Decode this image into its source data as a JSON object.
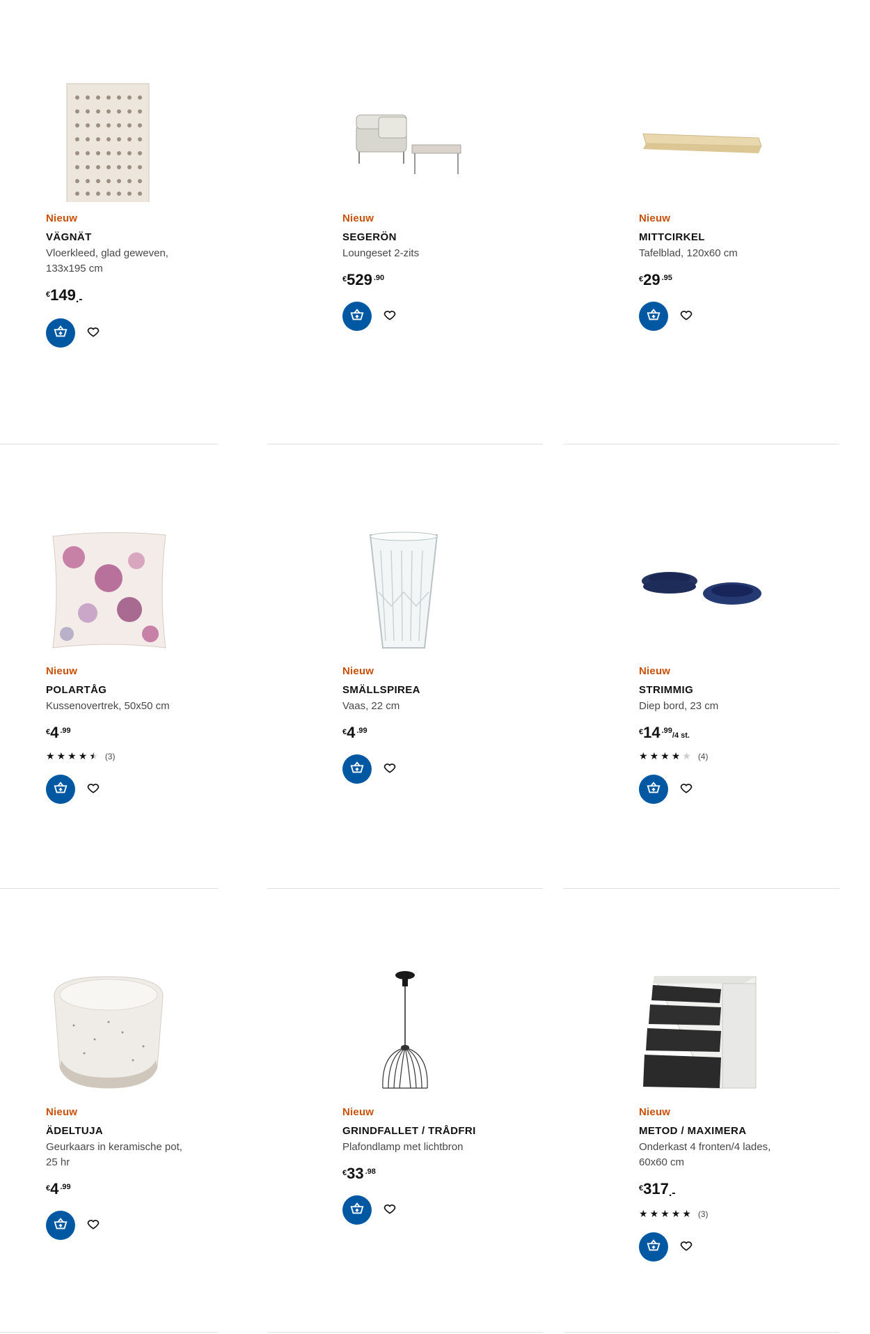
{
  "products": [
    {
      "badge": "Nieuw",
      "name": "VÄGNÄT",
      "desc": "Vloerkleed, glad geweven, 133x195 cm",
      "price": {
        "currency": "€",
        "int": "149",
        "dec": "",
        "suffix": ".-",
        "unit": ""
      },
      "rating": null
    },
    {
      "badge": "Nieuw",
      "name": "SEGERÖN",
      "desc": "Loungeset 2-zits",
      "price": {
        "currency": "€",
        "int": "529",
        "dec": ".90",
        "suffix": "",
        "unit": ""
      },
      "rating": null
    },
    {
      "badge": "Nieuw",
      "name": "MITTCIRKEL",
      "desc": "Tafelblad, 120x60 cm",
      "price": {
        "currency": "€",
        "int": "29",
        "dec": ".95",
        "suffix": "",
        "unit": ""
      },
      "rating": null
    },
    {
      "badge": "Nieuw",
      "name": "POLARTÅG",
      "desc": "Kussenovertrek, 50x50 cm",
      "price": {
        "currency": "€",
        "int": "4",
        "dec": ".99",
        "suffix": "",
        "unit": ""
      },
      "rating": {
        "stars": 4.5,
        "count": "(3)"
      }
    },
    {
      "badge": "Nieuw",
      "name": "SMÄLLSPIREA",
      "desc": "Vaas, 22 cm",
      "price": {
        "currency": "€",
        "int": "4",
        "dec": ".99",
        "suffix": "",
        "unit": ""
      },
      "rating": null
    },
    {
      "badge": "Nieuw",
      "name": "STRIMMIG",
      "desc": "Diep bord, 23 cm",
      "price": {
        "currency": "€",
        "int": "14",
        "dec": ".99",
        "suffix": "",
        "unit": "/4 st."
      },
      "rating": {
        "stars": 4,
        "count": "(4)"
      }
    },
    {
      "badge": "Nieuw",
      "name": "ÄDELTUJA",
      "desc": "Geurkaars in keramische pot, 25 hr",
      "price": {
        "currency": "€",
        "int": "4",
        "dec": ".99",
        "suffix": "",
        "unit": ""
      },
      "rating": null
    },
    {
      "badge": "Nieuw",
      "name": "GRINDFALLET / TRÅDFRI",
      "desc": "Plafondlamp met lichtbron",
      "price": {
        "currency": "€",
        "int": "33",
        "dec": ".98",
        "suffix": "",
        "unit": ""
      },
      "rating": null
    },
    {
      "badge": "Nieuw",
      "name": "METOD / MAXIMERA",
      "desc": "Onderkast 4 fronten/4 lades, 60x60 cm",
      "price": {
        "currency": "€",
        "int": "317",
        "dec": "",
        "suffix": ".-",
        "unit": ""
      },
      "rating": {
        "stars": 5,
        "count": "(3)"
      }
    }
  ],
  "icons": {
    "cart": "add-to-cart-icon",
    "favourite": "heart-icon",
    "star": "star-icon"
  },
  "colors": {
    "badge": "#ca5008",
    "cart_button": "#0058a3",
    "divider": "#dfdfdf"
  }
}
